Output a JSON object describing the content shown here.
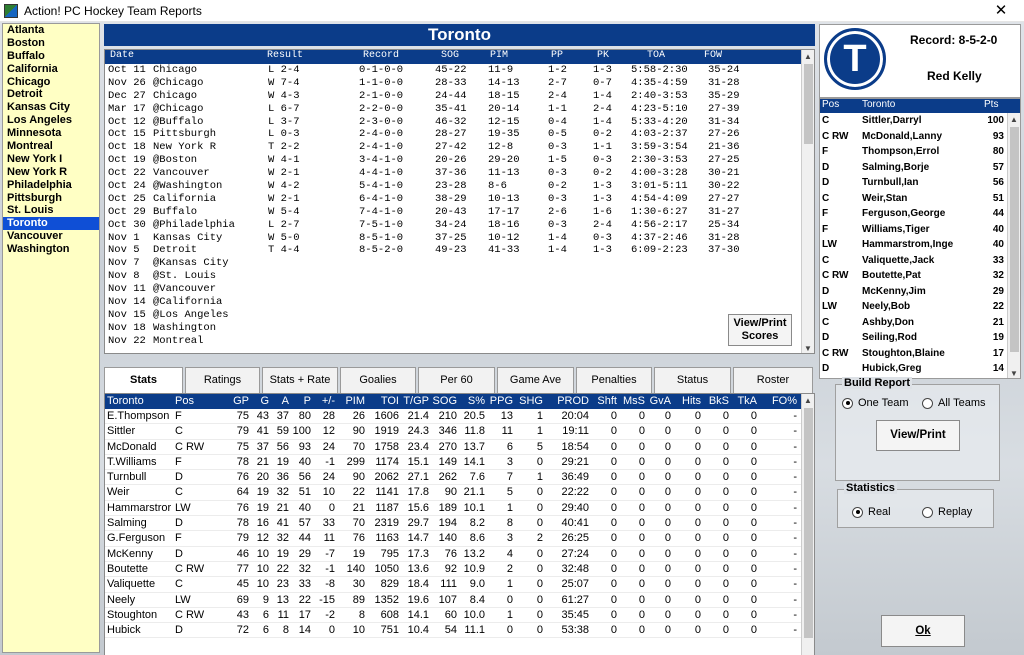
{
  "window": {
    "title": "Action! PC Hockey Team Reports",
    "close_label": "✕"
  },
  "teams": [
    "Atlanta",
    "Boston",
    "Buffalo",
    "California",
    "Chicago",
    "Detroit",
    "Kansas City",
    "Los Angeles",
    "Minnesota",
    "Montreal",
    "New York I",
    "New York R",
    "Philadelphia",
    "Pittsburgh",
    "St. Louis",
    "Toronto",
    "Vancouver",
    "Washington"
  ],
  "selected_team": "Toronto",
  "header_title": "Toronto",
  "schedule": {
    "columns": [
      "Date",
      "Result",
      "Record",
      "SOG",
      "PIM",
      "PP",
      "PK",
      "TOA",
      "FOW"
    ],
    "rows": [
      [
        "Oct 11",
        "Chicago",
        "L 2-4",
        "0-1-0-0",
        "45-22",
        "11-9",
        "1-2",
        "1-3",
        "5:58-2:30",
        "35-24"
      ],
      [
        "Nov 26",
        "@Chicago",
        "W 7-4",
        "1-1-0-0",
        "28-33",
        "14-13",
        "2-7",
        "0-7",
        "4:35-4:59",
        "31-28"
      ],
      [
        "Dec 27",
        "Chicago",
        "W 4-3",
        "2-1-0-0",
        "24-44",
        "18-15",
        "2-4",
        "1-4",
        "2:40-3:53",
        "35-29"
      ],
      [
        "Mar 17",
        "@Chicago",
        "L 6-7",
        "2-2-0-0",
        "35-41",
        "20-14",
        "1-1",
        "2-4",
        "4:23-5:10",
        "27-39"
      ],
      [
        "Oct 12",
        "@Buffalo",
        "L 3-7",
        "2-3-0-0",
        "46-32",
        "12-15",
        "0-4",
        "1-4",
        "5:33-4:20",
        "31-34"
      ],
      [
        "Oct 15",
        "Pittsburgh",
        "L 0-3",
        "2-4-0-0",
        "28-27",
        "19-35",
        "0-5",
        "0-2",
        "4:03-2:37",
        "27-26"
      ],
      [
        "Oct 18",
        "New York R",
        "T 2-2",
        "2-4-1-0",
        "27-42",
        "12-8",
        "0-3",
        "1-1",
        "3:59-3:54",
        "21-36"
      ],
      [
        "Oct 19",
        "@Boston",
        "W 4-1",
        "3-4-1-0",
        "20-26",
        "29-20",
        "1-5",
        "0-3",
        "2:30-3:53",
        "27-25"
      ],
      [
        "Oct 22",
        "Vancouver",
        "W 2-1",
        "4-4-1-0",
        "37-36",
        "11-13",
        "0-3",
        "0-2",
        "4:00-3:28",
        "30-21"
      ],
      [
        "Oct 24",
        "@Washington",
        "W 4-2",
        "5-4-1-0",
        "23-28",
        "8-6",
        "0-2",
        "1-3",
        "3:01-5:11",
        "30-22"
      ],
      [
        "Oct 25",
        "California",
        "W 2-1",
        "6-4-1-0",
        "38-29",
        "10-13",
        "0-3",
        "1-3",
        "4:54-4:09",
        "27-27"
      ],
      [
        "Oct 29",
        "Buffalo",
        "W 5-4",
        "7-4-1-0",
        "20-43",
        "17-17",
        "2-6",
        "1-6",
        "1:30-6:27",
        "31-27"
      ],
      [
        "Oct 30",
        "@Philadelphia",
        "L 2-7",
        "7-5-1-0",
        "34-24",
        "18-16",
        "0-3",
        "2-4",
        "4:56-2:17",
        "25-34"
      ],
      [
        "Nov 1",
        "Kansas City",
        "W 5-0",
        "8-5-1-0",
        "37-25",
        "10-12",
        "1-4",
        "0-3",
        "4:37-2:46",
        "31-28"
      ],
      [
        "Nov 5",
        "Detroit",
        "T 4-4",
        "8-5-2-0",
        "49-23",
        "41-33",
        "1-4",
        "1-3",
        "6:09-2:23",
        "37-30"
      ],
      [
        "Nov 7",
        "@Kansas City",
        "",
        "",
        "",
        "",
        "",
        "",
        "",
        ""
      ],
      [
        "Nov 8",
        "@St. Louis",
        "",
        "",
        "",
        "",
        "",
        "",
        "",
        ""
      ],
      [
        "Nov 11",
        "@Vancouver",
        "",
        "",
        "",
        "",
        "",
        "",
        "",
        ""
      ],
      [
        "Nov 14",
        "@California",
        "",
        "",
        "",
        "",
        "",
        "",
        "",
        ""
      ],
      [
        "Nov 15",
        "@Los Angeles",
        "",
        "",
        "",
        "",
        "",
        "",
        "",
        ""
      ],
      [
        "Nov 18",
        "Washington",
        "",
        "",
        "",
        "",
        "",
        "",
        "",
        ""
      ],
      [
        "Nov 22",
        "Montreal",
        "",
        "",
        "",
        "",
        "",
        "",
        "",
        ""
      ]
    ]
  },
  "view_print_scores_label": "View/Print Scores",
  "tabs": [
    "Stats",
    "Ratings",
    "Stats + Rate",
    "Goalies",
    "Per 60",
    "Game Ave",
    "Penalties",
    "Status",
    "Roster"
  ],
  "active_tab": "Stats",
  "stats": {
    "columns": [
      "Toronto",
      "Pos",
      "GP",
      "G",
      "A",
      "P",
      "+/-",
      "PIM",
      "TOI",
      "T/GP",
      "SOG",
      "S%",
      "PPG",
      "SHG",
      "PROD",
      "Shft",
      "MsS",
      "GvA",
      "Hits",
      "BkS",
      "TkA",
      "FO%"
    ],
    "rows": [
      [
        "E.Thompson",
        "F",
        "75",
        "43",
        "37",
        "80",
        "28",
        "26",
        "1606",
        "21.4",
        "210",
        "20.5",
        "13",
        "1",
        "20:04",
        "0",
        "0",
        "0",
        "0",
        "0",
        "0",
        "-"
      ],
      [
        "Sittler",
        "C",
        "79",
        "41",
        "59",
        "100",
        "12",
        "90",
        "1919",
        "24.3",
        "346",
        "11.8",
        "11",
        "1",
        "19:11",
        "0",
        "0",
        "0",
        "0",
        "0",
        "0",
        "-"
      ],
      [
        "McDonald",
        "C RW",
        "75",
        "37",
        "56",
        "93",
        "24",
        "70",
        "1758",
        "23.4",
        "270",
        "13.7",
        "6",
        "5",
        "18:54",
        "0",
        "0",
        "0",
        "0",
        "0",
        "0",
        "-"
      ],
      [
        "T.Williams",
        "F",
        "78",
        "21",
        "19",
        "40",
        "-1",
        "299",
        "1174",
        "15.1",
        "149",
        "14.1",
        "3",
        "0",
        "29:21",
        "0",
        "0",
        "0",
        "0",
        "0",
        "0",
        "-"
      ],
      [
        "Turnbull",
        "D",
        "76",
        "20",
        "36",
        "56",
        "24",
        "90",
        "2062",
        "27.1",
        "262",
        "7.6",
        "7",
        "1",
        "36:49",
        "0",
        "0",
        "0",
        "0",
        "0",
        "0",
        "-"
      ],
      [
        "Weir",
        "C",
        "64",
        "19",
        "32",
        "51",
        "10",
        "22",
        "1141",
        "17.8",
        "90",
        "21.1",
        "5",
        "0",
        "22:22",
        "0",
        "0",
        "0",
        "0",
        "0",
        "0",
        "-"
      ],
      [
        "Hammarstror",
        "LW",
        "76",
        "19",
        "21",
        "40",
        "0",
        "21",
        "1187",
        "15.6",
        "189",
        "10.1",
        "1",
        "0",
        "29:40",
        "0",
        "0",
        "0",
        "0",
        "0",
        "0",
        "-"
      ],
      [
        "Salming",
        "D",
        "78",
        "16",
        "41",
        "57",
        "33",
        "70",
        "2319",
        "29.7",
        "194",
        "8.2",
        "8",
        "0",
        "40:41",
        "0",
        "0",
        "0",
        "0",
        "0",
        "0",
        "-"
      ],
      [
        "G.Ferguson",
        "F",
        "79",
        "12",
        "32",
        "44",
        "11",
        "76",
        "1163",
        "14.7",
        "140",
        "8.6",
        "3",
        "2",
        "26:25",
        "0",
        "0",
        "0",
        "0",
        "0",
        "0",
        "-"
      ],
      [
        "McKenny",
        "D",
        "46",
        "10",
        "19",
        "29",
        "-7",
        "19",
        "795",
        "17.3",
        "76",
        "13.2",
        "4",
        "0",
        "27:24",
        "0",
        "0",
        "0",
        "0",
        "0",
        "0",
        "-"
      ],
      [
        "Boutette",
        "C RW",
        "77",
        "10",
        "22",
        "32",
        "-1",
        "140",
        "1050",
        "13.6",
        "92",
        "10.9",
        "2",
        "0",
        "32:48",
        "0",
        "0",
        "0",
        "0",
        "0",
        "0",
        "-"
      ],
      [
        "Valiquette",
        "C",
        "45",
        "10",
        "23",
        "33",
        "-8",
        "30",
        "829",
        "18.4",
        "111",
        "9.0",
        "1",
        "0",
        "25:07",
        "0",
        "0",
        "0",
        "0",
        "0",
        "0",
        "-"
      ],
      [
        "Neely",
        "LW",
        "69",
        "9",
        "13",
        "22",
        "-15",
        "89",
        "1352",
        "19.6",
        "107",
        "8.4",
        "0",
        "0",
        "61:27",
        "0",
        "0",
        "0",
        "0",
        "0",
        "0",
        "-"
      ],
      [
        "Stoughton",
        "C RW",
        "43",
        "6",
        "11",
        "17",
        "-2",
        "8",
        "608",
        "14.1",
        "60",
        "10.0",
        "1",
        "0",
        "35:45",
        "0",
        "0",
        "0",
        "0",
        "0",
        "0",
        "-"
      ],
      [
        "Hubick",
        "D",
        "72",
        "6",
        "8",
        "14",
        "0",
        "10",
        "751",
        "10.4",
        "54",
        "11.1",
        "0",
        "0",
        "53:38",
        "0",
        "0",
        "0",
        "0",
        "0",
        "0",
        "-"
      ]
    ]
  },
  "team_card": {
    "logo_letter": "T",
    "record": "Record: 8-5-2-0",
    "coach": "Red Kelly"
  },
  "roster": {
    "columns": [
      "Pos",
      "Toronto",
      "Pts"
    ],
    "rows": [
      [
        "C",
        "Sittler,Darryl",
        "100"
      ],
      [
        "C RW",
        "McDonald,Lanny",
        "93"
      ],
      [
        "F",
        "Thompson,Errol",
        "80"
      ],
      [
        "D",
        "Salming,Borje",
        "57"
      ],
      [
        "D",
        "Turnbull,Ian",
        "56"
      ],
      [
        "C",
        "Weir,Stan",
        "51"
      ],
      [
        "F",
        "Ferguson,George",
        "44"
      ],
      [
        "F",
        "Williams,Tiger",
        "40"
      ],
      [
        "LW",
        "Hammarstrom,Inge",
        "40"
      ],
      [
        "C",
        "Valiquette,Jack",
        "33"
      ],
      [
        "C RW",
        "Boutette,Pat",
        "32"
      ],
      [
        "D",
        "McKenny,Jim",
        "29"
      ],
      [
        "LW",
        "Neely,Bob",
        "22"
      ],
      [
        "C",
        "Ashby,Don",
        "21"
      ],
      [
        "D",
        "Seiling,Rod",
        "19"
      ],
      [
        "C RW",
        "Stoughton,Blaine",
        "17"
      ],
      [
        "D",
        "Hubick,Greg",
        "14"
      ]
    ]
  },
  "build_report": {
    "title": "Build Report",
    "one_team": "One Team",
    "all_teams": "All Teams",
    "selected": "One Team",
    "button": "View/Print"
  },
  "statistics": {
    "title": "Statistics",
    "real": "Real",
    "replay": "Replay",
    "selected": "Real"
  },
  "ok_label": "Ok",
  "colors": {
    "header_blue": "#0b3c89",
    "list_bg": "#ffffc4",
    "selection": "#0f4fd6"
  }
}
